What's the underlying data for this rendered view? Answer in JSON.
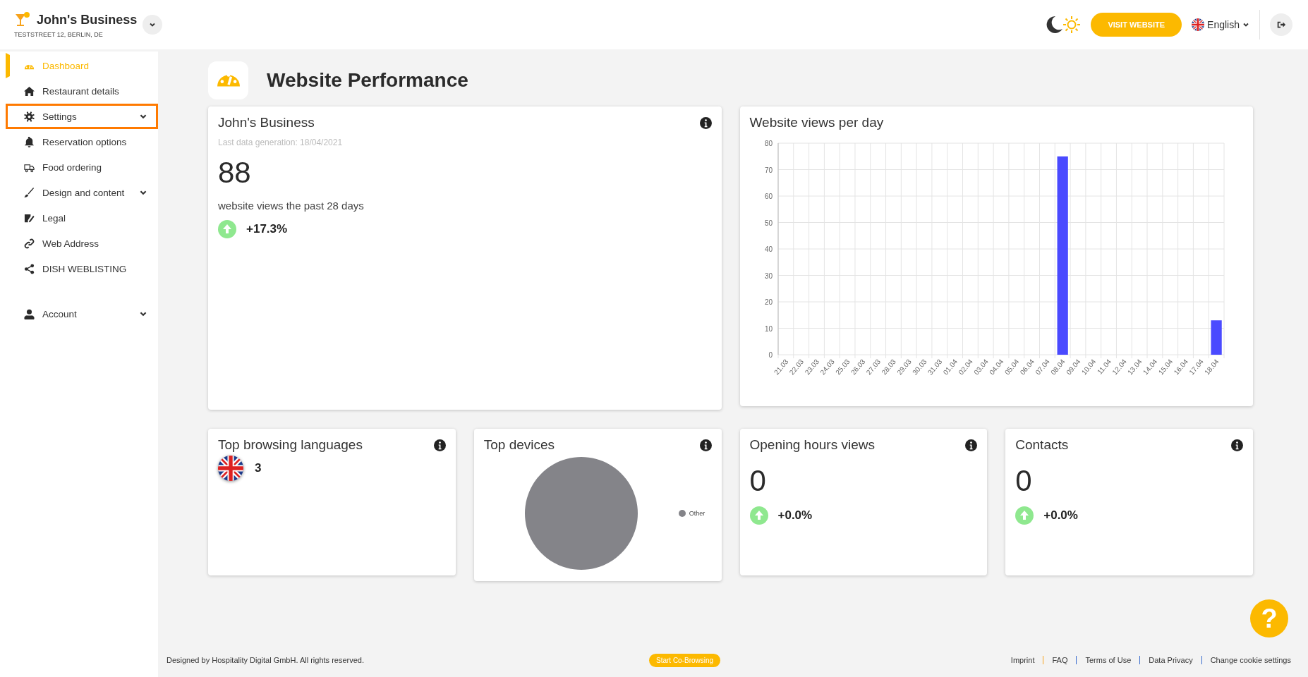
{
  "business": {
    "name": "John's Business",
    "address": "TESTSTREET 12, BERLIN, DE"
  },
  "header": {
    "visit_button": "VISIT WEBSITE",
    "language": "English"
  },
  "sidebar": {
    "items": [
      {
        "label": "Dashboard",
        "selected": true,
        "expandable": false,
        "highlighted": false
      },
      {
        "label": "Restaurant details",
        "selected": false,
        "expandable": false,
        "highlighted": false
      },
      {
        "label": "Settings",
        "selected": false,
        "expandable": true,
        "highlighted": true
      },
      {
        "label": "Reservation options",
        "selected": false,
        "expandable": false,
        "highlighted": false
      },
      {
        "label": "Food ordering",
        "selected": false,
        "expandable": false,
        "highlighted": false
      },
      {
        "label": "Design and content",
        "selected": false,
        "expandable": true,
        "highlighted": false
      },
      {
        "label": "Legal",
        "selected": false,
        "expandable": false,
        "highlighted": false
      },
      {
        "label": "Web Address",
        "selected": false,
        "expandable": false,
        "highlighted": false
      },
      {
        "label": "DISH WEBLISTING",
        "selected": false,
        "expandable": false,
        "highlighted": false
      }
    ],
    "account": {
      "label": "Account",
      "selected": false,
      "expandable": true,
      "highlighted": false
    }
  },
  "page_title": "Website Performance",
  "summary_card": {
    "title": "John's Business",
    "subtitle": "Last data generation: 18/04/2021",
    "value": "88",
    "caption": "website views the past 28 days",
    "change": "+17.3%"
  },
  "views_chart": {
    "title": "Website views per day",
    "chart_data": {
      "type": "bar",
      "categories": [
        "21.03",
        "22.03",
        "23.03",
        "24.03",
        "25.03",
        "26.03",
        "27.03",
        "28.03",
        "29.03",
        "30.03",
        "31.03",
        "01.04",
        "02.04",
        "03.04",
        "04.04",
        "05.04",
        "06.04",
        "07.04",
        "08.04",
        "09.04",
        "10.04",
        "11.04",
        "12.04",
        "13.04",
        "14.04",
        "15.04",
        "16.04",
        "17.04",
        "18.04"
      ],
      "series": [
        {
          "color": "#4a4aff",
          "values": [
            0,
            0,
            0,
            0,
            0,
            0,
            0,
            0,
            0,
            0,
            0,
            0,
            0,
            0,
            0,
            0,
            0,
            0,
            75,
            0,
            0,
            0,
            0,
            0,
            0,
            0,
            0,
            0,
            13
          ]
        }
      ],
      "ylim": [
        0,
        80
      ],
      "yticks": [
        0,
        10,
        20,
        30,
        40,
        50,
        60,
        70,
        80
      ],
      "grid": true
    }
  },
  "languages_card": {
    "title": "Top browsing languages",
    "count": "3"
  },
  "devices_card": {
    "title": "Top devices",
    "chart_data": {
      "type": "pie",
      "categories": [
        "Other"
      ],
      "series": [
        {
          "color": "#848489",
          "values": [
            100
          ]
        }
      ]
    }
  },
  "stat_cards": [
    {
      "title": "Opening hours views",
      "value": "0",
      "change": "+0.0%"
    },
    {
      "title": "Contacts",
      "value": "0",
      "change": "+0.0%"
    }
  ],
  "footer": {
    "copyright": "Designed by Hospitality Digital GmbH. All rights reserved.",
    "cobrowse_button": "Start Co-Browsing",
    "links": [
      "Imprint",
      "FAQ",
      "Terms of Use",
      "Data Privacy",
      "Change cookie settings"
    ]
  },
  "help_button": "?"
}
